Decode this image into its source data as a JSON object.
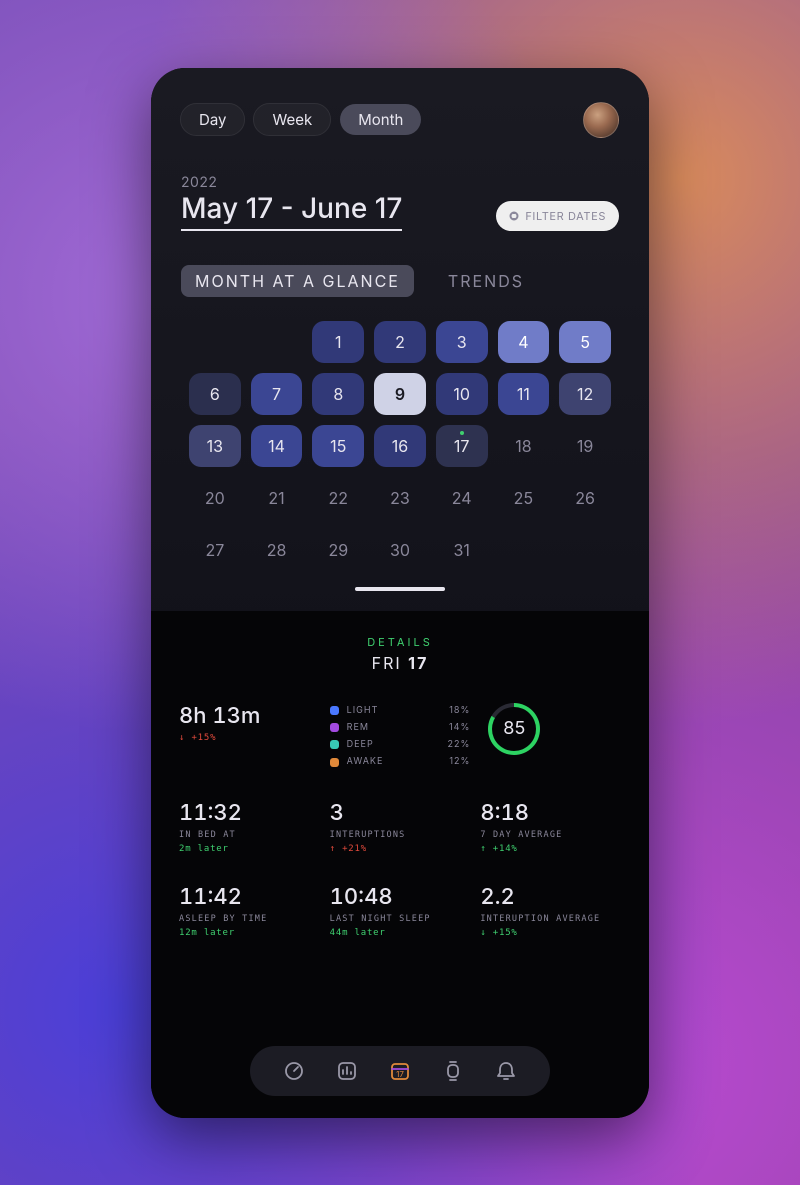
{
  "header": {
    "segments": [
      "Day",
      "Week",
      "Month"
    ],
    "active": "Month"
  },
  "dates": {
    "year": "2022",
    "range": "May 17 - June 17",
    "filter_label": "FILTER DATES"
  },
  "tabs": {
    "items": [
      "MONTH  AT  A  GLANCE",
      "TRENDS"
    ],
    "active": 0
  },
  "calendar": {
    "cells": [
      {
        "d": "",
        "cls": "empty"
      },
      {
        "d": "",
        "cls": "empty"
      },
      {
        "d": "1",
        "cls": "c1"
      },
      {
        "d": "2",
        "cls": "c1"
      },
      {
        "d": "3",
        "cls": "c2"
      },
      {
        "d": "4",
        "cls": "c3"
      },
      {
        "d": "5",
        "cls": "c3"
      },
      {
        "d": "6",
        "cls": "c5"
      },
      {
        "d": "7",
        "cls": "c2"
      },
      {
        "d": "8",
        "cls": "c1"
      },
      {
        "d": "9",
        "cls": "sel"
      },
      {
        "d": "10",
        "cls": "c1"
      },
      {
        "d": "11",
        "cls": "c2"
      },
      {
        "d": "12",
        "cls": "c4"
      },
      {
        "d": "13",
        "cls": "c4"
      },
      {
        "d": "14",
        "cls": "c2"
      },
      {
        "d": "15",
        "cls": "c2"
      },
      {
        "d": "16",
        "cls": "c1"
      },
      {
        "d": "17",
        "cls": "today"
      },
      {
        "d": "18",
        "cls": "future"
      },
      {
        "d": "19",
        "cls": "future"
      },
      {
        "d": "20",
        "cls": "future"
      },
      {
        "d": "21",
        "cls": "future"
      },
      {
        "d": "22",
        "cls": "future"
      },
      {
        "d": "23",
        "cls": "future"
      },
      {
        "d": "24",
        "cls": "future"
      },
      {
        "d": "25",
        "cls": "future"
      },
      {
        "d": "26",
        "cls": "future"
      },
      {
        "d": "27",
        "cls": "future"
      },
      {
        "d": "28",
        "cls": "future"
      },
      {
        "d": "29",
        "cls": "future"
      },
      {
        "d": "30",
        "cls": "future"
      },
      {
        "d": "31",
        "cls": "future"
      }
    ]
  },
  "details": {
    "label": "DETAILS",
    "day": "FRI",
    "date": "17",
    "score": "85",
    "legend": [
      {
        "name": "LIGHT",
        "pct": "18%",
        "color": "#4a78ff"
      },
      {
        "name": "REM",
        "pct": "14%",
        "color": "#a34ae0"
      },
      {
        "name": "DEEP",
        "pct": "22%",
        "color": "#38c8b4"
      },
      {
        "name": "AWAKE",
        "pct": "12%",
        "color": "#e0893a"
      }
    ],
    "stats": [
      {
        "value": "8h 13m",
        "label": "",
        "delta": "+15%",
        "dir": "down",
        "color": "r"
      },
      {
        "legend": true
      },
      {
        "score": true
      },
      {
        "value": "11:32",
        "label": "IN BED AT",
        "delta": "2m later",
        "dir": "",
        "color": "g"
      },
      {
        "value": "3",
        "label": "INTERUPTIONS",
        "delta": "+21%",
        "dir": "up",
        "color": "r"
      },
      {
        "value": "8:18",
        "label": "7 DAY AVERAGE",
        "delta": "+14%",
        "dir": "up",
        "color": "g"
      },
      {
        "value": "11:42",
        "label": "ASLEEP BY TIME",
        "delta": "12m later",
        "dir": "",
        "color": "g"
      },
      {
        "value": "10:48",
        "label": "LAST NIGHT SLEEP",
        "delta": "44m later",
        "dir": "",
        "color": "g"
      },
      {
        "value": "2.2",
        "label": "INTERUPTION AVERAGE",
        "delta": "+15%",
        "dir": "down",
        "color": "g"
      }
    ]
  },
  "nav": {
    "items": [
      "dashboard",
      "stats",
      "calendar",
      "watch",
      "alerts"
    ],
    "active": 2
  }
}
